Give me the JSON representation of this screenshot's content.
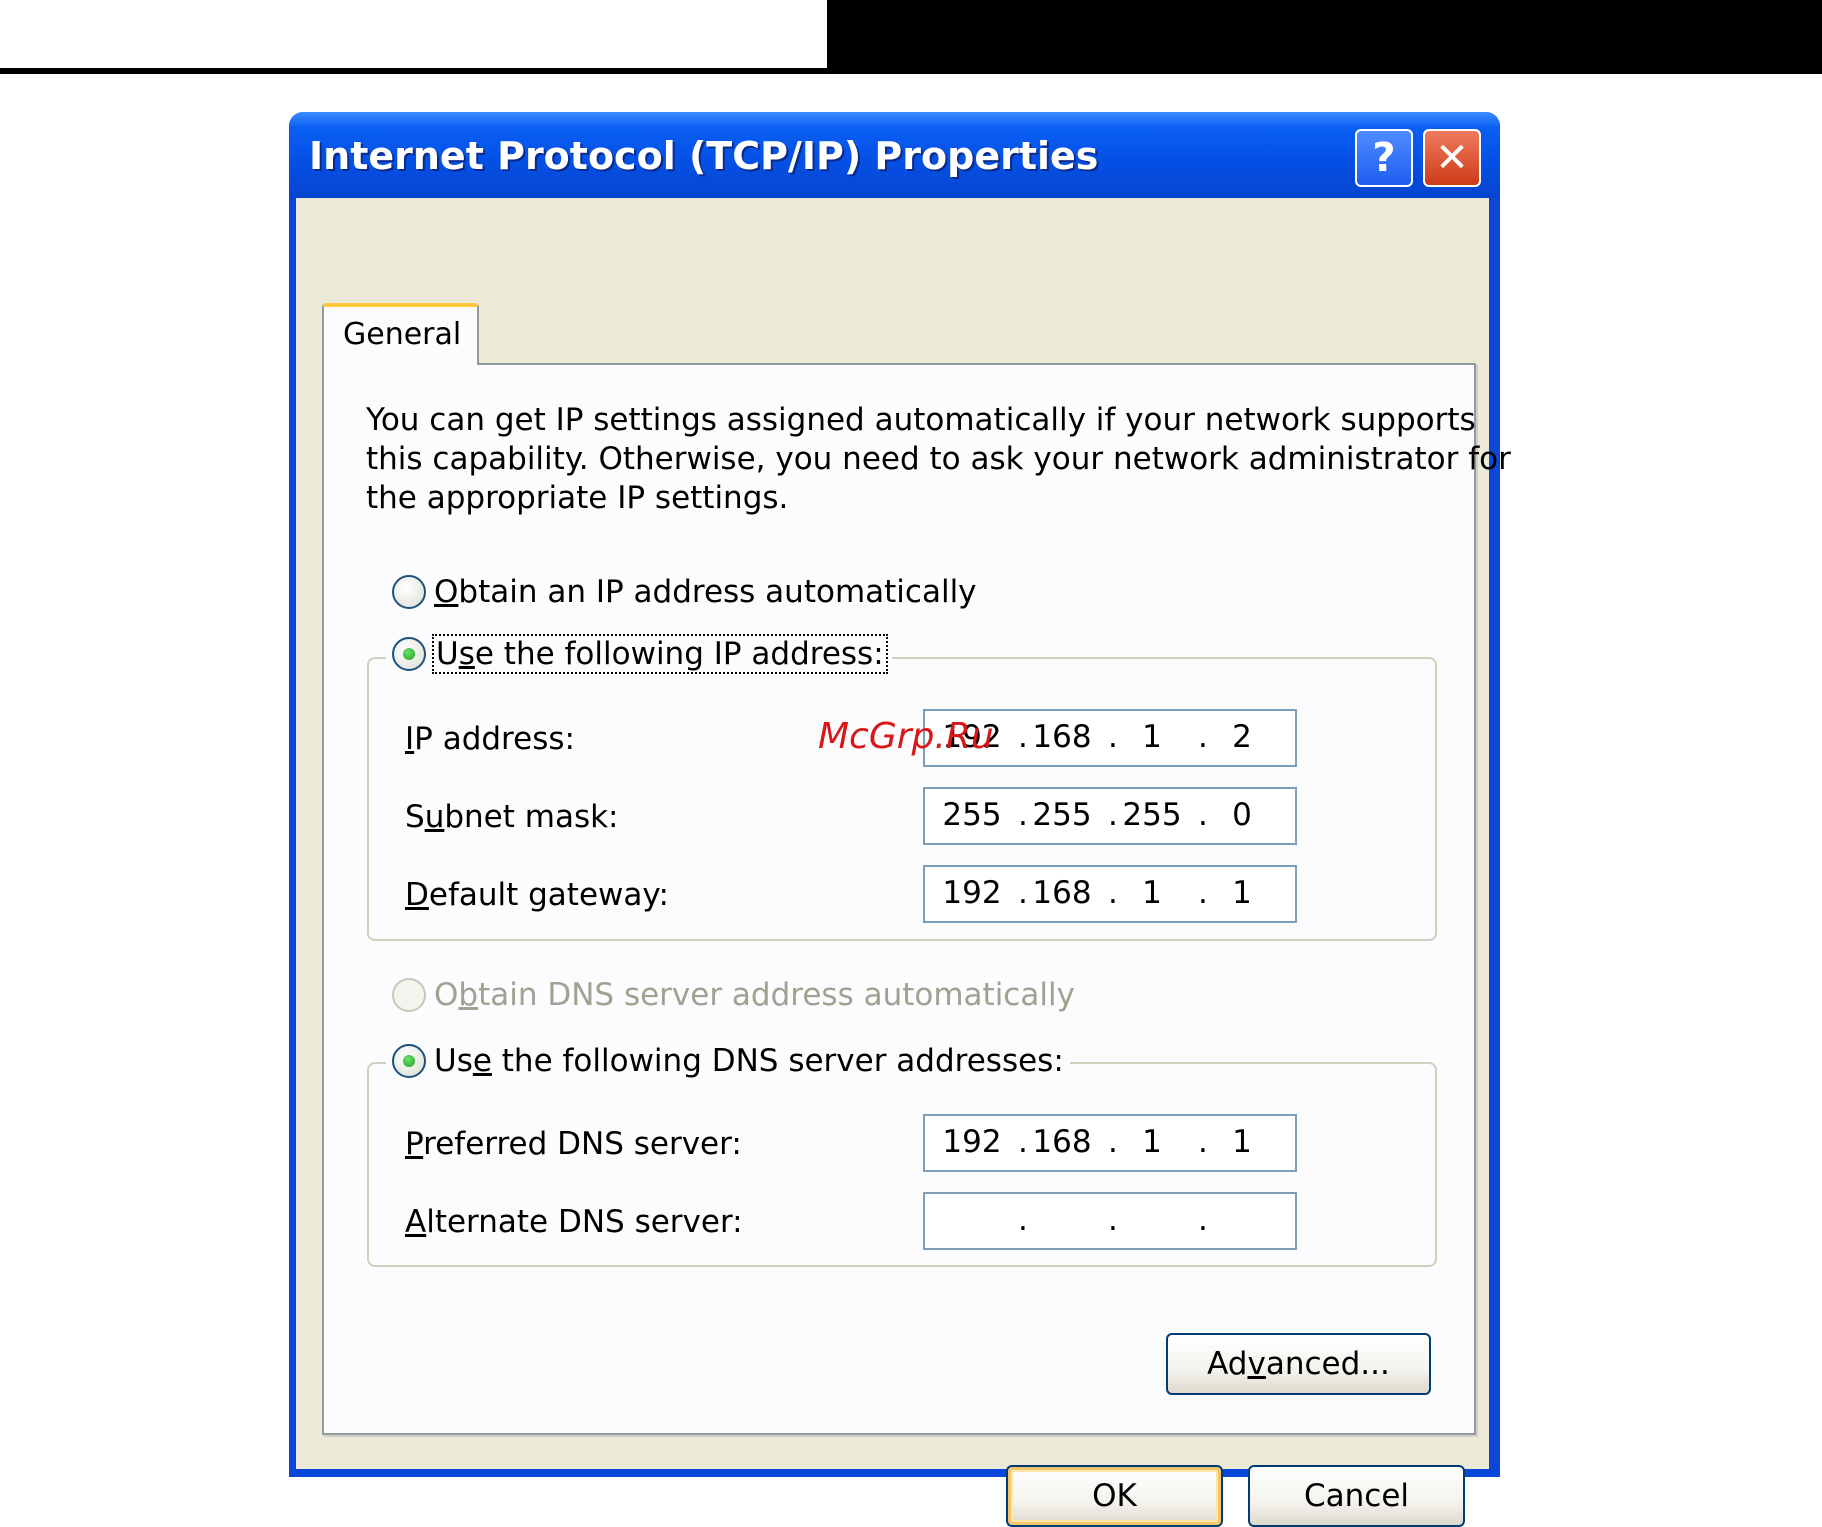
{
  "window": {
    "title": "Internet Protocol (TCP/IP) Properties",
    "help_glyph": "?",
    "close_glyph": "✕"
  },
  "tabs": [
    {
      "label": "General",
      "selected": true
    }
  ],
  "intro_lines": [
    "You can get IP settings assigned automatically if your network supports",
    "this capability. Otherwise, you need to ask your network administrator for",
    "the appropriate IP settings."
  ],
  "ip_mode": {
    "auto": {
      "mnemonic": "O",
      "rest": "btain an IP address automatically",
      "checked": false
    },
    "manual": {
      "pre": "U",
      "mnemonic": "s",
      "rest": "e the following IP address:",
      "checked": true
    }
  },
  "ip_fields": {
    "ip_address": {
      "mnemonic": "I",
      "rest": "P address:",
      "octets": [
        "192",
        "168",
        "1",
        "2"
      ]
    },
    "subnet_mask": {
      "pre": "S",
      "mnemonic": "u",
      "rest": "bnet mask:",
      "octets": [
        "255",
        "255",
        "255",
        "0"
      ]
    },
    "gateway": {
      "mnemonic": "D",
      "rest": "efault gateway:",
      "octets": [
        "192",
        "168",
        "1",
        "1"
      ]
    }
  },
  "dns_mode": {
    "auto": {
      "pre": "O",
      "mnemonic": "b",
      "rest": "tain DNS server address automatically",
      "checked": false,
      "disabled": true
    },
    "manual": {
      "pre": "Us",
      "mnemonic": "e",
      "rest": " the following DNS server addresses:",
      "checked": true
    }
  },
  "dns_fields": {
    "preferred": {
      "mnemonic": "P",
      "rest": "referred DNS server:",
      "octets": [
        "192",
        "168",
        "1",
        "1"
      ]
    },
    "alternate": {
      "mnemonic": "A",
      "rest": "lternate DNS server:",
      "octets": [
        "",
        "",
        "",
        ""
      ]
    }
  },
  "buttons": {
    "advanced": {
      "pre": "Ad",
      "mnemonic": "v",
      "rest": "anced..."
    },
    "ok": "OK",
    "cancel": "Cancel"
  },
  "watermark": "McGrp.Ru",
  "colors": {
    "titlebar": "#0551e6",
    "dialog_face": "#ece9d8",
    "tab_highlight": "#ffc83c",
    "field_border": "#7f9db9",
    "radio_checked": "#21a121"
  }
}
